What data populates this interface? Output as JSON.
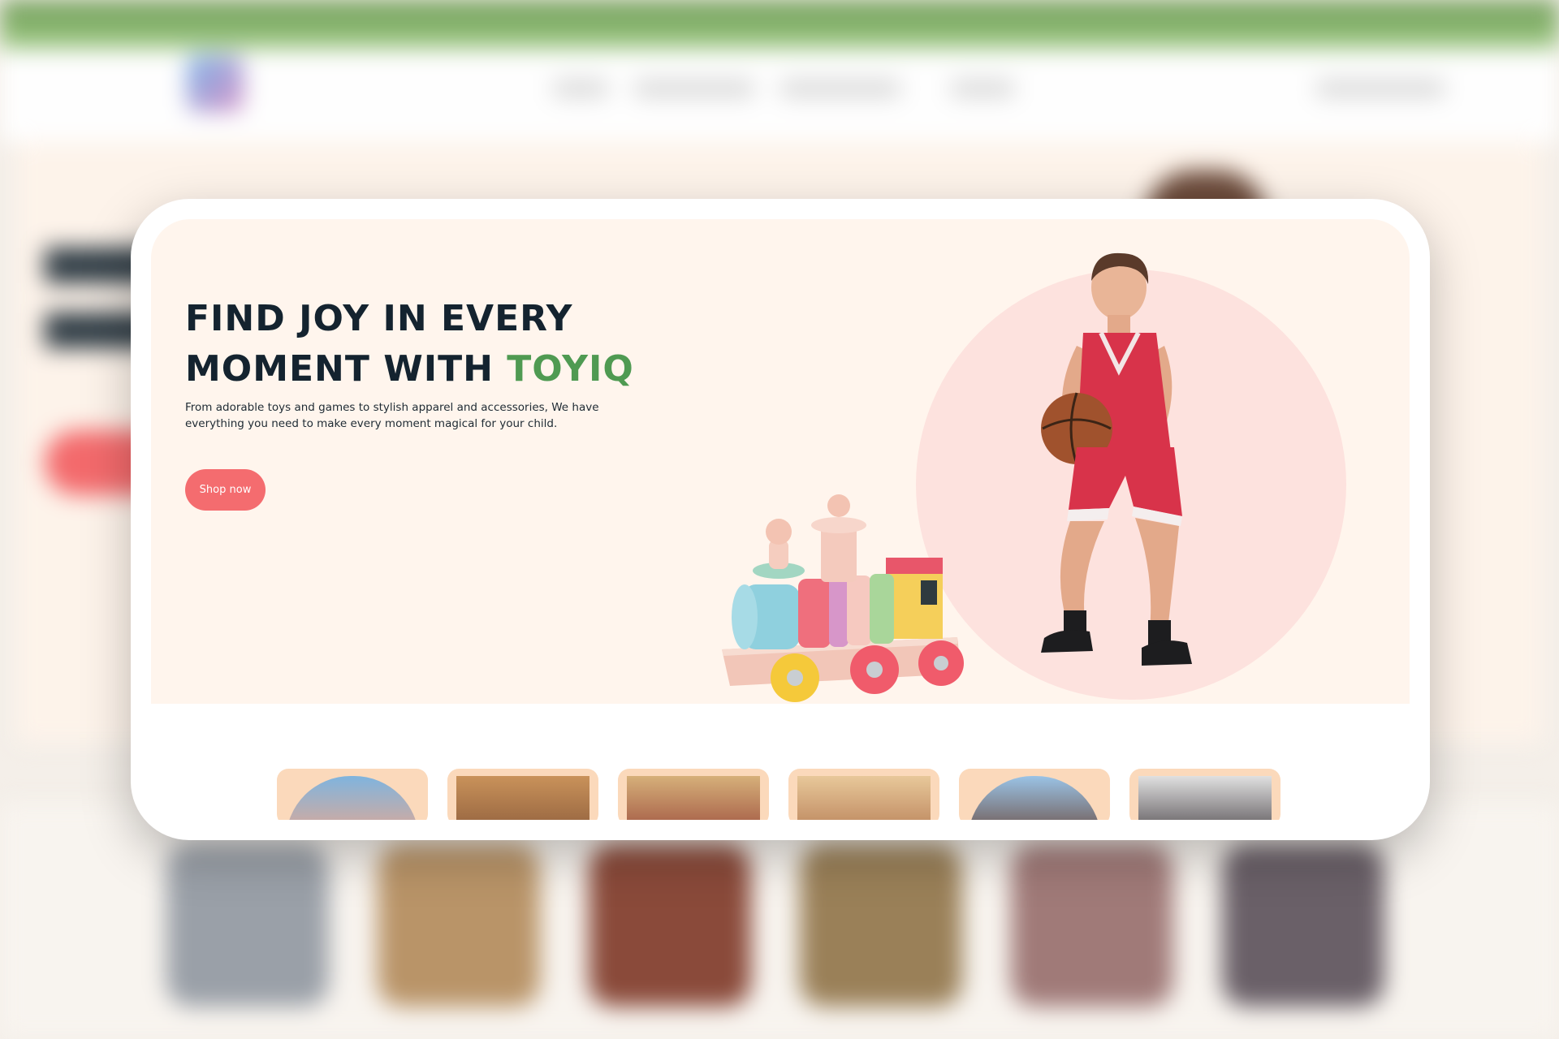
{
  "hero": {
    "title_line1": "Find joy in every",
    "title_line2_prefix": "moment with",
    "title_brand": "ToyIQ",
    "description": "From adorable toys and games to stylish apparel and accessories, We have everything you need to make every moment magical for your child.",
    "shop_button_label": "Shop now"
  },
  "colors": {
    "primary_text": "#14232f",
    "brand_green": "#4f9a52",
    "accent_coral": "#f46c6f",
    "hero_bg": "#fff5ed",
    "circle_pink": "#fde2de",
    "thumb_frame": "#fbd9bb"
  },
  "images": {
    "train": "wooden-toy-train-image",
    "kid": "boy-with-basketball-image"
  },
  "categories": [
    {
      "image": "category-thumbnail-1"
    },
    {
      "image": "category-thumbnail-2"
    },
    {
      "image": "category-thumbnail-3"
    },
    {
      "image": "category-thumbnail-4"
    },
    {
      "image": "category-thumbnail-5"
    },
    {
      "image": "category-thumbnail-6"
    }
  ]
}
